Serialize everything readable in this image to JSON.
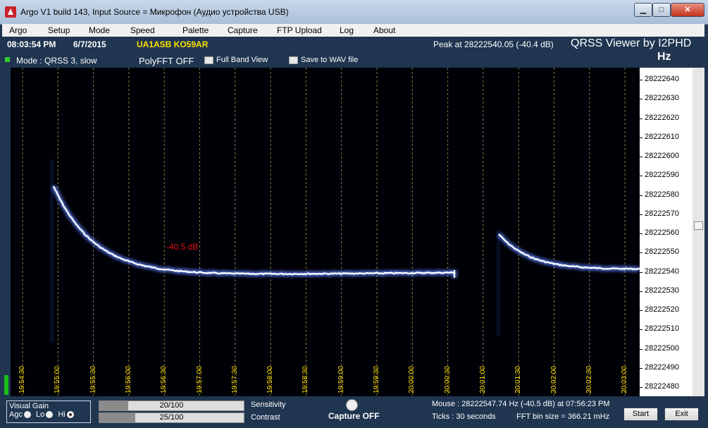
{
  "window": {
    "title": "Argo V1 build 143, Input Source = Микрофон (Аудио устройства USB)",
    "minimize_glyph": "▁",
    "maximize_glyph": "□",
    "close_glyph": "✕"
  },
  "menu": [
    "Argo",
    "Setup",
    "Mode",
    "Speed",
    "Palette",
    "Capture",
    "FTP Upload",
    "Log",
    "About"
  ],
  "info": {
    "time": "08:03:54 PM",
    "date": "6/7/2015",
    "callsign": "UA1ASB KO59AR",
    "peak": "Peak at 28222540.05 (-40.4 dB)",
    "viewer_name": "QRSS Viewer by I2PHD",
    "unit": "Hz",
    "mode": "Mode : QRSS 3, slow",
    "polyfft": "PolyFFT OFF",
    "full_band_view": "Full Band View",
    "save_wav": "Save to WAV file"
  },
  "waterfall": {
    "peak_marker": "-40.5 dB",
    "time_ticks": [
      "19:54:30",
      "19:55:00",
      "19:55:30",
      "19:56:00",
      "19:56:30",
      "19:57:00",
      "19:57:30",
      "19:58:00",
      "19:58:30",
      "19:59:00",
      "19:59:30",
      "20:00:00",
      "20:00:30",
      "20:01:00",
      "20:01:30",
      "20:02:00",
      "20:02:30",
      "20:03:00"
    ],
    "freq_ticks": [
      "28222640",
      "28222630",
      "28222620",
      "28222610",
      "28222600",
      "28222590",
      "28222580",
      "28222570",
      "28222560",
      "28222550",
      "28222540",
      "28222530",
      "28222520",
      "28222510",
      "28222500",
      "28222490",
      "28222480"
    ],
    "trace_color": "#ffffff"
  },
  "controls": {
    "visual_gain_title": "Visual Gain",
    "agc_label": "Agc",
    "lo_label": "Lo",
    "hi_label": "Hi",
    "sensitivity_value": "20/100",
    "sensitivity_fraction": 0.2,
    "sensitivity_label": "Sensitivity",
    "contrast_value": "25/100",
    "contrast_fraction": 0.25,
    "contrast_label": "Contrast",
    "capture": "Capture OFF",
    "mouse": "Mouse :  28222547.74 Hz  (-40.5 dB) at 07:56:23 PM",
    "ticks": "Ticks   : 30 seconds",
    "fft_bin": "FFT bin size = 366.21 mHz",
    "start": "Start",
    "exit": "Exit"
  }
}
